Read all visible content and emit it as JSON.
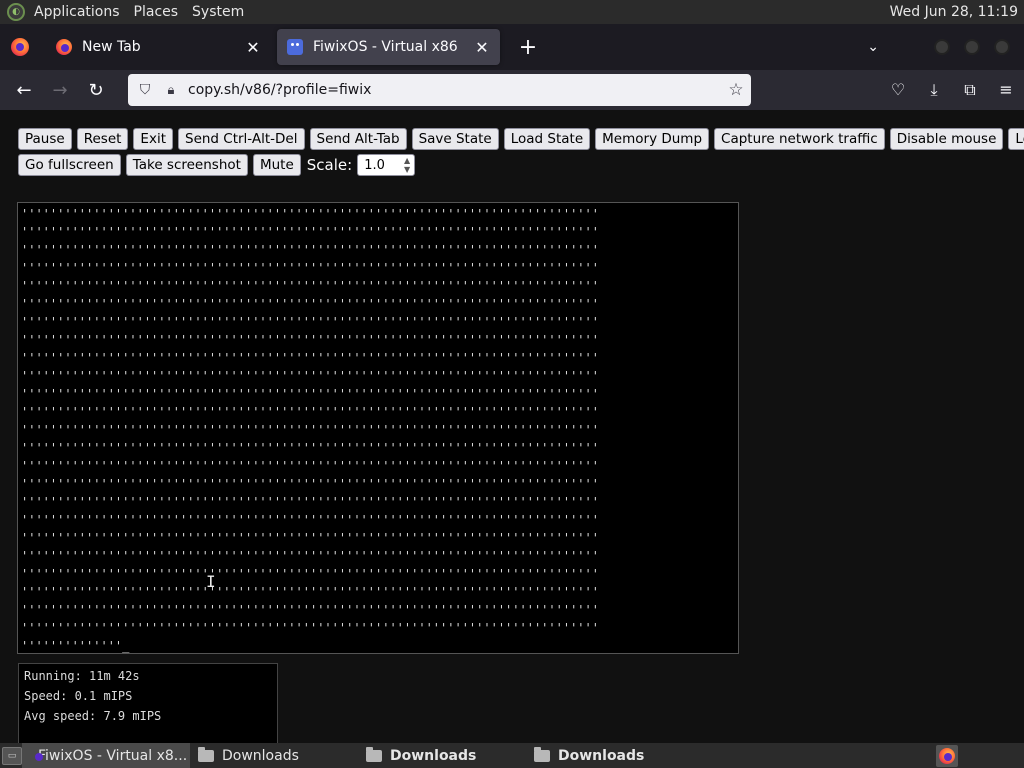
{
  "top_panel": {
    "menus": [
      "Applications",
      "Places",
      "System"
    ],
    "clock": "Wed Jun 28, 11:19"
  },
  "tabs": [
    {
      "label": "New Tab",
      "active": false
    },
    {
      "label": "FiwixOS - Virtual x86",
      "active": true
    }
  ],
  "navbar": {
    "url": "copy.sh/v86/?profile=fiwix"
  },
  "controls": {
    "row1": [
      "Pause",
      "Reset",
      "Exit",
      "Send Ctrl-Alt-Del",
      "Send Alt-Tab",
      "Save State",
      "Load State",
      "Memory Dump",
      "Capture network traffic",
      "Disable mouse",
      "Lock mouse"
    ],
    "row2": [
      "Go fullscreen",
      "Take screenshot",
      "Mute"
    ],
    "scale_label": "Scale:",
    "scale_value": "1.0"
  },
  "screen": {
    "fill_char": "'",
    "full_rows": 24,
    "chars_per_row": 80,
    "last_row": "''''''''''''''_"
  },
  "status": {
    "running": "Running: 11m 42s",
    "speed": "Speed: 0.1 mIPS",
    "avg_speed": "Avg speed: 7.9 mIPS"
  },
  "taskbar": {
    "items": [
      {
        "label": "FiwixOS - Virtual x8...",
        "icon": "firefox-icon",
        "active": true,
        "bold": false
      },
      {
        "label": "Downloads",
        "icon": "folder-icon",
        "active": false,
        "bold": false
      },
      {
        "label": "Downloads",
        "icon": "folder-icon",
        "active": false,
        "bold": true
      },
      {
        "label": "Downloads",
        "icon": "folder-icon",
        "active": false,
        "bold": true
      }
    ]
  },
  "colors": {
    "browser_chrome": "#1c1b22",
    "nav_bar": "#2b2a33",
    "page_bg": "#111111",
    "panel_bg": "#2b2b2b"
  }
}
